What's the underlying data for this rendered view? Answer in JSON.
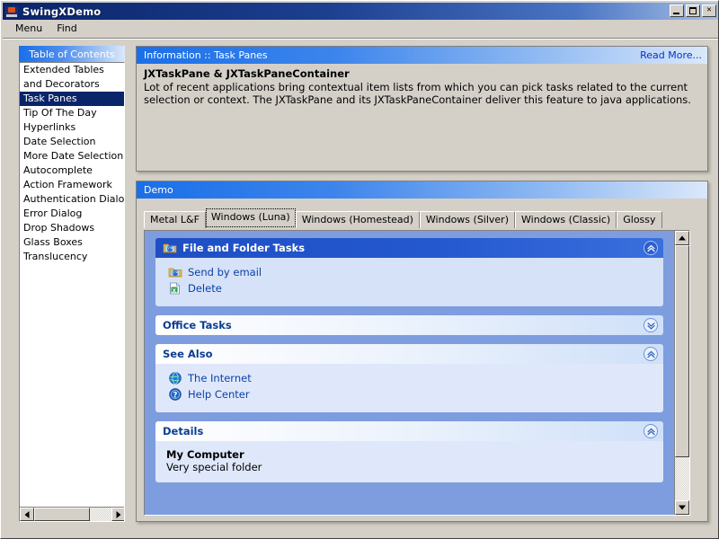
{
  "window": {
    "title": "SwingXDemo",
    "icon": "java-cup-icon",
    "buttons": {
      "minimize": "_",
      "maximize": "□",
      "close": "×"
    }
  },
  "menubar": {
    "items": [
      {
        "label": "Menu",
        "name": "menu-menu"
      },
      {
        "label": "Find",
        "name": "menu-find"
      }
    ]
  },
  "toc": {
    "header": "Table of Contents",
    "items": [
      {
        "label": "Extended Tables and Decorators",
        "selected": false
      },
      {
        "label": "Task Panes",
        "selected": true
      },
      {
        "label": "Tip Of The Day",
        "selected": false
      },
      {
        "label": "Hyperlinks",
        "selected": false
      },
      {
        "label": "Date Selection",
        "selected": false
      },
      {
        "label": "More Date Selection",
        "selected": false
      },
      {
        "label": "Autocomplete",
        "selected": false
      },
      {
        "label": "Action Framework",
        "selected": false
      },
      {
        "label": "Authentication Dialogs",
        "selected": false
      },
      {
        "label": "Error Dialog",
        "selected": false
      },
      {
        "label": "Drop Shadows",
        "selected": false
      },
      {
        "label": "Glass Boxes",
        "selected": false
      },
      {
        "label": "Translucency",
        "selected": false
      }
    ]
  },
  "info": {
    "header_title": "Information :: Task Panes",
    "read_more": "Read More...",
    "heading": "JXTaskPane & JXTaskPaneContainer",
    "body": "Lot of recent applications bring contextual item lists from which you can pick tasks related to the current selection or context. The JXTaskPane and its JXTaskPaneContainer deliver this feature to java applications."
  },
  "demo": {
    "header_title": "Demo",
    "tabs": [
      {
        "label": "Metal L&F",
        "selected": false
      },
      {
        "label": "Windows (Luna)",
        "selected": true
      },
      {
        "label": "Windows (Homestead)",
        "selected": false
      },
      {
        "label": "Windows (Silver)",
        "selected": false
      },
      {
        "label": "Windows (Classic)",
        "selected": false
      },
      {
        "label": "Glossy",
        "selected": false
      }
    ],
    "taskpanes": [
      {
        "title": "File and Folder Tasks",
        "style": "special",
        "expanded": true,
        "icon": "folder-share-icon",
        "toggle_icon": "chevron-up-icon",
        "links": [
          {
            "label": "Send by email",
            "icon": "folder-share-icon"
          },
          {
            "label": "Delete",
            "icon": "document-delete-icon"
          }
        ]
      },
      {
        "title": "Office Tasks",
        "style": "normal",
        "expanded": false,
        "toggle_icon": "chevron-down-icon",
        "links": []
      },
      {
        "title": "See Also",
        "style": "normal",
        "expanded": true,
        "toggle_icon": "chevron-up-icon",
        "links": [
          {
            "label": "The Internet",
            "icon": "globe-icon"
          },
          {
            "label": "Help Center",
            "icon": "help-question-icon"
          }
        ]
      },
      {
        "title": "Details",
        "style": "normal",
        "expanded": true,
        "toggle_icon": "chevron-up-icon",
        "detail_title": "My Computer",
        "detail_sub": "Very special folder"
      }
    ]
  },
  "colors": {
    "titlebar_start": "#0a246a",
    "panel_header_start": "#1a6fe8",
    "selection": "#0a246a",
    "link": "#0a3fa8",
    "taskpane_container_bg": "#7e9ddf",
    "taskpane_special_header": "#2458cf",
    "face": "#d4d0c8"
  }
}
